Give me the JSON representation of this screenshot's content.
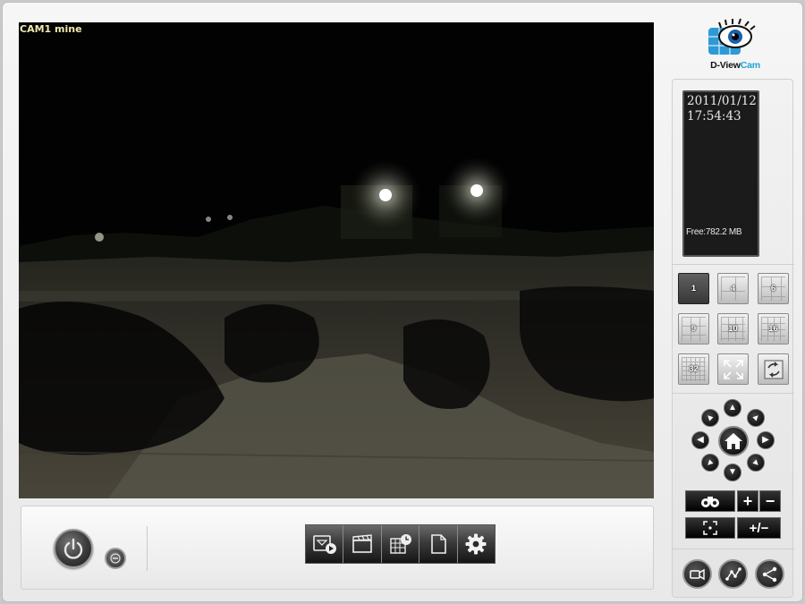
{
  "video": {
    "camera_label": "CAM1 mine"
  },
  "info": {
    "date": "2011/01/12",
    "time": "17:54:43",
    "free_space": "Free:782.2 MB"
  },
  "logo": {
    "text_main": "D-View",
    "text_accent": "Cam",
    "accent_color": "#1fa3d8"
  },
  "layouts": [
    {
      "label": "1",
      "icon": "layout-1-icon"
    },
    {
      "label": "4",
      "icon": "layout-4-icon"
    },
    {
      "label": "6",
      "icon": "layout-6-icon"
    },
    {
      "label": "9",
      "icon": "layout-9-icon"
    },
    {
      "label": "10",
      "icon": "layout-10-icon"
    },
    {
      "label": "16",
      "icon": "layout-16-icon"
    },
    {
      "label": "32",
      "icon": "layout-32-icon"
    }
  ],
  "view_controls": {
    "fullscreen_icon": "fullscreen-icon",
    "switch_icon": "rotate-view-icon"
  },
  "ptz": {
    "home_icon": "home-icon",
    "focus_plus": "+",
    "focus_minus": "−",
    "zoom_symbol": "+/−"
  },
  "toolbar": {
    "buttons": [
      "playback-icon",
      "record-icon",
      "schedule-icon",
      "log-icon",
      "settings-icon"
    ]
  },
  "colors": {
    "panel_bg": "#ededed",
    "button_dark": "#1a1a1a",
    "overlay_text": "#f2e9b0"
  }
}
